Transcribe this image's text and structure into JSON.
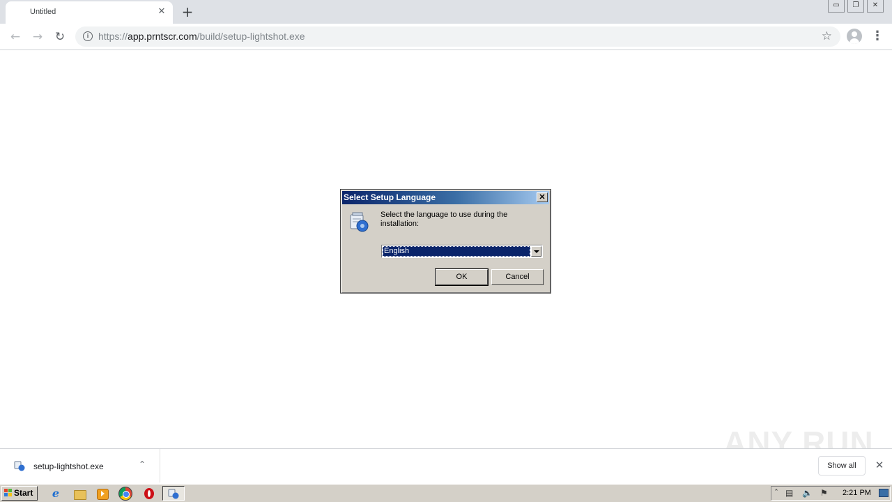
{
  "browser": {
    "tab_title": "Untitled",
    "tab_close": "✕",
    "new_tab": "+",
    "url_scheme": "https://",
    "url_host": "app.prntscr.com",
    "url_path": "/build/setup-lightshot.exe",
    "window_controls": [
      "▭",
      "❐",
      "✕"
    ]
  },
  "dialog": {
    "title": "Select Setup Language",
    "close": "✕",
    "message": "Select the language to use during the installation:",
    "language_selected": "English",
    "ok_label": "OK",
    "cancel_label": "Cancel"
  },
  "download_shelf": {
    "file_name": "setup-lightshot.exe",
    "show_all_label": "Show all",
    "close": "✕"
  },
  "watermark": "ANY RUN",
  "taskbar": {
    "start_label": "Start",
    "clock": "2:21 PM"
  },
  "colors": {
    "dialog_title_start": "#0a246a",
    "dialog_title_end": "#a6caf0",
    "classic_face": "#d4d0c8",
    "select_highlight": "#0a246a"
  }
}
